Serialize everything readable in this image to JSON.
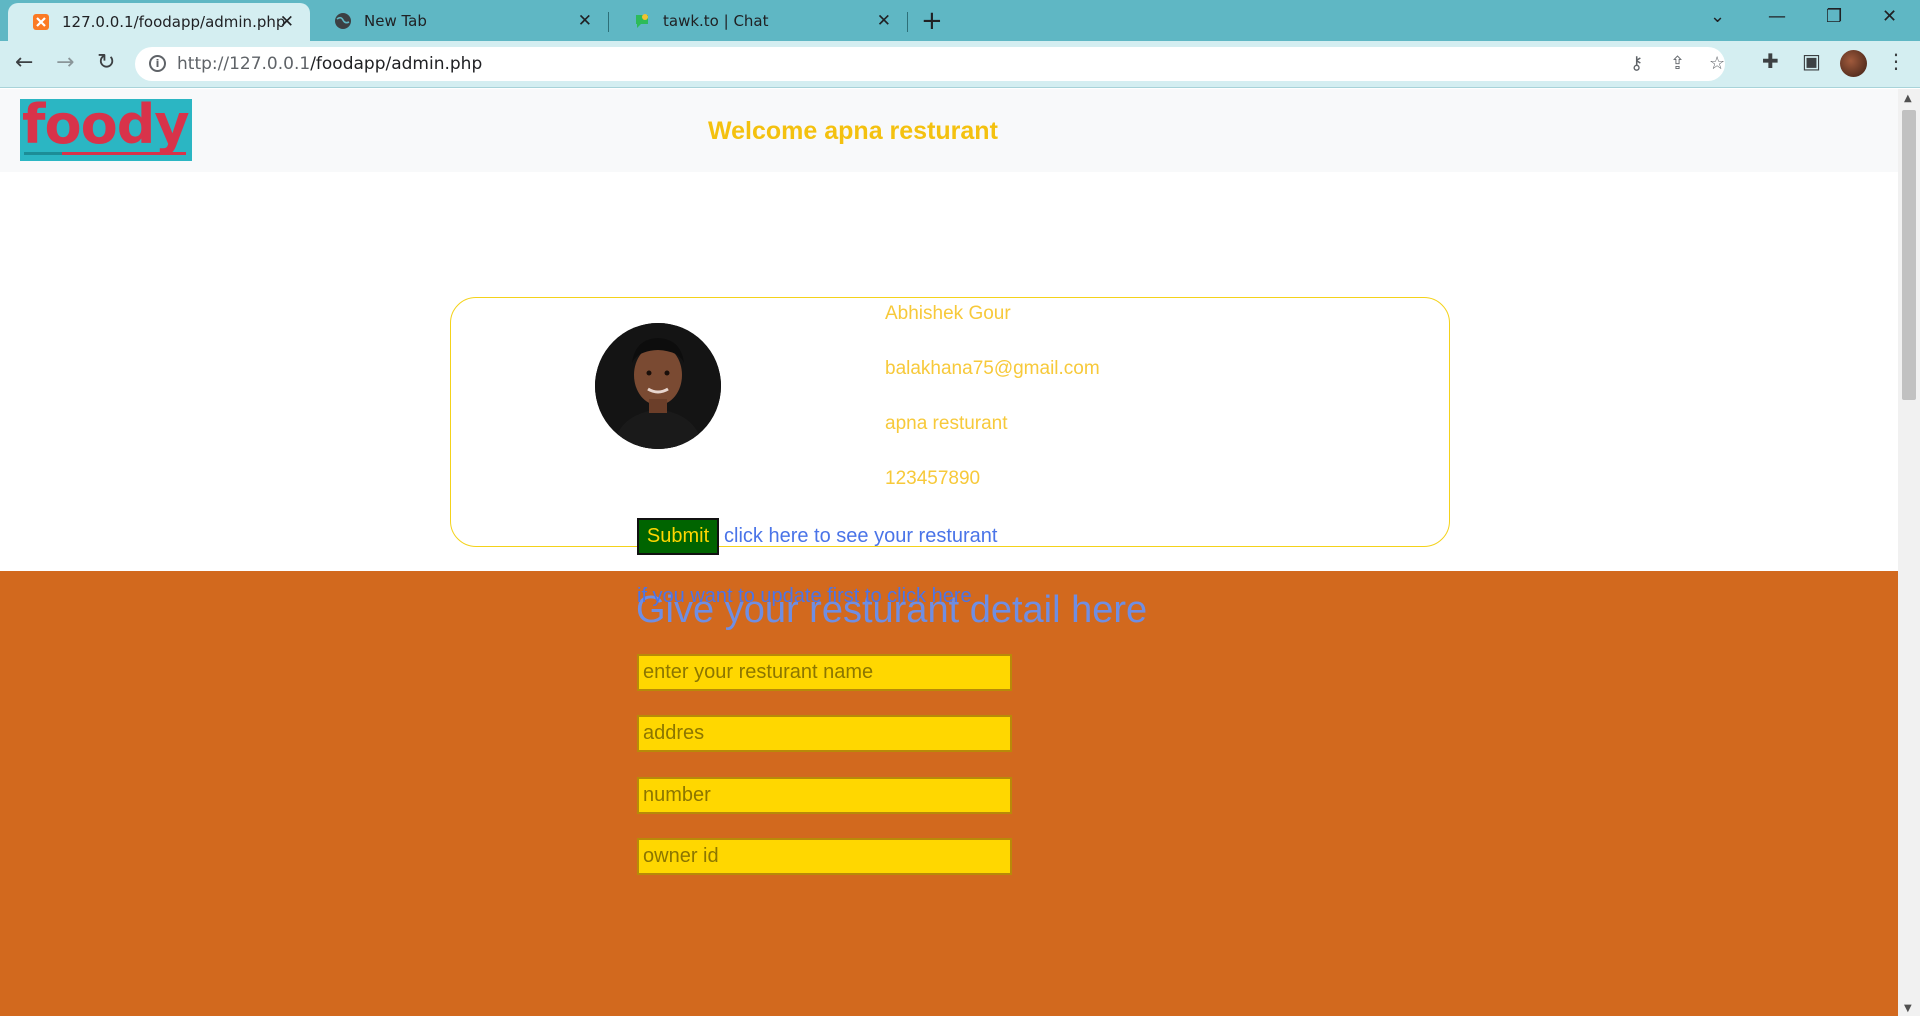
{
  "browser": {
    "tabs": [
      {
        "title": "127.0.0.1/foodapp/admin.php",
        "icon": "xampp-icon",
        "active": true
      },
      {
        "title": "New Tab",
        "icon": "globe-icon",
        "active": false
      },
      {
        "title": "tawk.to | Chat",
        "icon": "tawk-icon",
        "active": false
      }
    ],
    "url_host": "http://127.0.0.1",
    "url_path": "/foodapp/admin.php",
    "colors": {
      "chrome": "#5fb7c4",
      "toolbar": "#d4eef1"
    }
  },
  "header": {
    "logo_text": "foody",
    "welcome": "Welcome apna resturant"
  },
  "profile": {
    "name": "Abhishek Gour",
    "email": "balakhana75@gmail.com",
    "restaurant": "apna resturant",
    "phone": "123457890"
  },
  "detail_form": {
    "title": "Give your resturant detail here",
    "fields": [
      {
        "placeholder": "enter your resturant name"
      },
      {
        "placeholder": "addres"
      },
      {
        "placeholder": "number"
      },
      {
        "placeholder": "owner id"
      }
    ],
    "submit_label": "Submit",
    "see_link": "click here to see your resturant",
    "update_link": "if you want to update first to click here"
  },
  "colors": {
    "accent_yellow": "#ffd700",
    "section_orange": "#d2691e",
    "link_blue": "#4a74e8",
    "submit_green": "#006400"
  }
}
